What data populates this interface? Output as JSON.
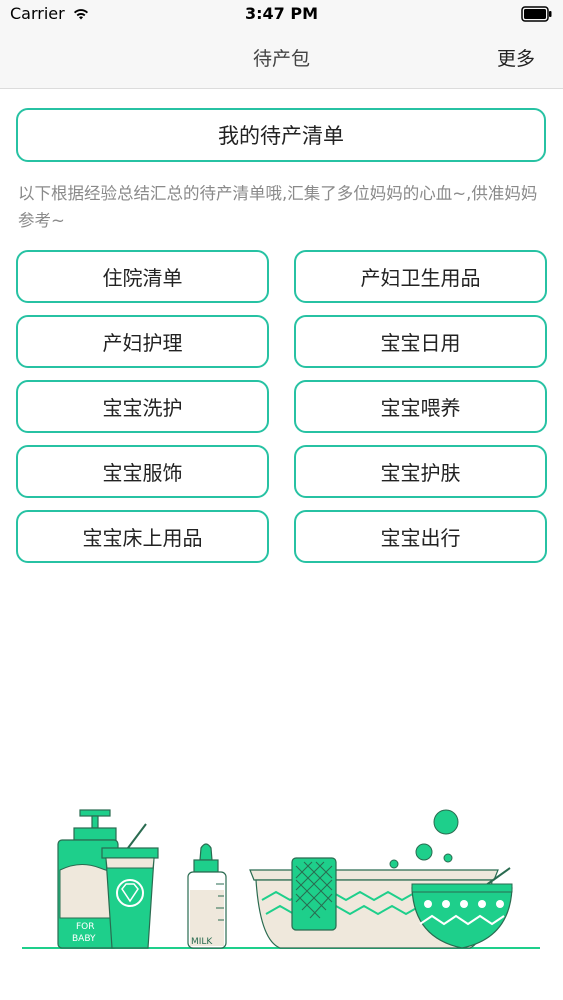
{
  "status_bar": {
    "carrier": "Carrier",
    "time": "3:47 PM"
  },
  "nav": {
    "title": "待产包",
    "more_label": "更多"
  },
  "main": {
    "my_list_label": "我的待产清单",
    "intro": "以下根据经验总结汇总的待产清单哦,汇集了多位妈妈的心血~,供准妈妈参考~",
    "categories": [
      "住院清单",
      "产妇卫生用品",
      "产妇护理",
      "宝宝日用",
      "宝宝洗护",
      "宝宝喂养",
      "宝宝服饰",
      "宝宝护肤",
      "宝宝床上用品",
      "宝宝出行"
    ]
  },
  "illustration": {
    "bottle_text_1": "FOR",
    "bottle_text_2": "BABY",
    "milk_text": "MILK"
  },
  "colors": {
    "accent": "#27c2a3",
    "illustration_green": "#1ecf8b",
    "illustration_beige": "#efe8dc"
  }
}
